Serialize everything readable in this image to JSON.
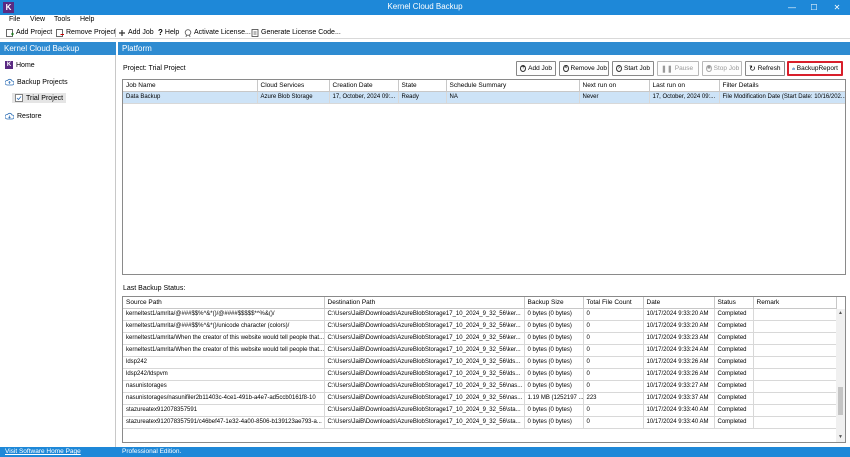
{
  "window": {
    "title": "Kernel Cloud Backup",
    "logo_letter": "K",
    "minimize": "—",
    "maximize": "☐",
    "close": "✕"
  },
  "menu": [
    "File",
    "View",
    "Tools",
    "Help"
  ],
  "toolbar": {
    "add_project": "Add Project",
    "remove_project": "Remove Project",
    "add_job": "Add Job",
    "help": "Help",
    "activate_license": "Activate License...",
    "generate_license": "Generate License Code..."
  },
  "sidebar": {
    "header": "Kernel Cloud Backup",
    "home": "Home",
    "backup_projects": "Backup Projects",
    "trial_project": "Trial Project",
    "restore": "Restore"
  },
  "platform": {
    "header": "Platform",
    "project_label": "Project: Trial Project",
    "buttons": {
      "add_job": "Add Job",
      "remove_job": "Remove Job",
      "start_job": "Start Job",
      "pause": "Pause",
      "stop_job": "Stop Job",
      "refresh": "Refresh",
      "backup_report": "BackupReport"
    }
  },
  "jobs_table": {
    "columns": [
      "Job Name",
      "Cloud Services",
      "Creation Date",
      "State",
      "Schedule Summary",
      "Next run on",
      "Last run on",
      "Filter Details"
    ],
    "rows": [
      [
        "Data Backup",
        "Azure Blob Storage",
        "17, October, 2024 09:...",
        "Ready",
        "NA",
        "Never",
        "17, October, 2024 09:...",
        "File Modification Date (Start Date: 10/16/202..."
      ]
    ]
  },
  "status": {
    "label": "Last Backup Status:",
    "columns": [
      "Source Path",
      "Destination Path",
      "Backup Size",
      "Total File Count",
      "Date",
      "Status",
      "Remark"
    ],
    "rows": [
      [
        "kerneltest1/amrita/@###$$%^&*()/@####$$$$$*^%&()/",
        "C:\\Users\\JaiB\\Downloads\\AzureBlobStorage17_10_2024_9_32_56\\ker...",
        "0 bytes (0 bytes)",
        "0",
        "10/17/2024 9:33:20 AM",
        "Completed",
        ""
      ],
      [
        "kerneltest1/amrita/@###$$%^&*()/unicode character (colors)/",
        "C:\\Users\\JaiB\\Downloads\\AzureBlobStorage17_10_2024_9_32_56\\ker...",
        "0 bytes (0 bytes)",
        "0",
        "10/17/2024 9:33:20 AM",
        "Completed",
        ""
      ],
      [
        "kerneltest1/amrita/When the creator of this website would tell people that...",
        "C:\\Users\\JaiB\\Downloads\\AzureBlobStorage17_10_2024_9_32_56\\ker...",
        "0 bytes (0 bytes)",
        "0",
        "10/17/2024 9:33:23 AM",
        "Completed",
        ""
      ],
      [
        "kerneltest1/amrita/When the creator of this website would tell people that...",
        "C:\\Users\\JaiB\\Downloads\\AzureBlobStorage17_10_2024_9_32_56\\ker...",
        "0 bytes (0 bytes)",
        "0",
        "10/17/2024 9:33:24 AM",
        "Completed",
        ""
      ],
      [
        "ldsp242",
        "C:\\Users\\JaiB\\Downloads\\AzureBlobStorage17_10_2024_9_32_56\\lds...",
        "0 bytes (0 bytes)",
        "0",
        "10/17/2024 9:33:26 AM",
        "Completed",
        ""
      ],
      [
        "ldsp242/ldspvm",
        "C:\\Users\\JaiB\\Downloads\\AzureBlobStorage17_10_2024_9_32_56\\lds...",
        "0 bytes (0 bytes)",
        "0",
        "10/17/2024 9:33:26 AM",
        "Completed",
        ""
      ],
      [
        "nasunistorages",
        "C:\\Users\\JaiB\\Downloads\\AzureBlobStorage17_10_2024_9_32_56\\nas...",
        "0 bytes (0 bytes)",
        "0",
        "10/17/2024 9:33:27 AM",
        "Completed",
        ""
      ],
      [
        "nasunistorages/nasunifiler2b11403c-4ce1-491b-a4e7-ad5ccb0161f8-10",
        "C:\\Users\\JaiB\\Downloads\\AzureBlobStorage17_10_2024_9_32_56\\nas...",
        "1.19 MB (1252197 ...",
        "223",
        "10/17/2024 9:33:37 AM",
        "Completed",
        ""
      ],
      [
        "stazureatex912078357591",
        "C:\\Users\\JaiB\\Downloads\\AzureBlobStorage17_10_2024_9_32_56\\sta...",
        "0 bytes (0 bytes)",
        "0",
        "10/17/2024 9:33:40 AM",
        "Completed",
        ""
      ],
      [
        "stazureatex912078357591/c46bef47-1e32-4a00-8506-b139123ae793-a...",
        "C:\\Users\\JaiB\\Downloads\\AzureBlobStorage17_10_2024_9_32_56\\sta...",
        "0 bytes (0 bytes)",
        "0",
        "10/17/2024 9:33:40 AM",
        "Completed",
        ""
      ]
    ]
  },
  "statusbar": {
    "link": "Visit Software Home Page",
    "edition": "Professional Edition."
  },
  "colors": {
    "titlebar": "#1e88d8",
    "panel_header": "#2e8bd1",
    "selected_row": "#cde3f7",
    "focus_border": "#d81e2a",
    "logo": "#5a2a82"
  }
}
